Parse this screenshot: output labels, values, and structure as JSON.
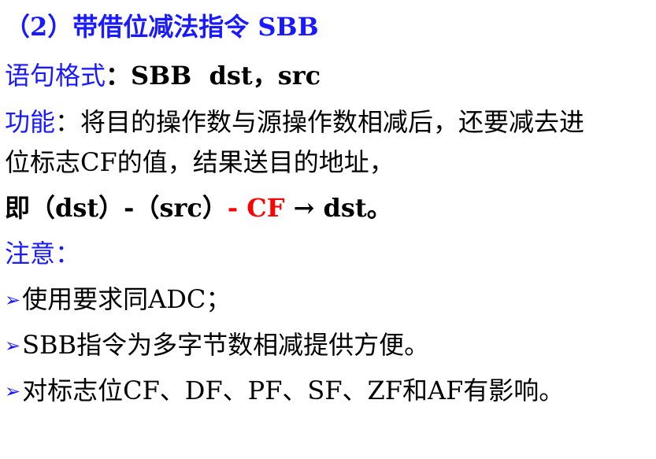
{
  "heading": "（2）带借位减法指令 SBB",
  "syntax": {
    "label": "语句格式",
    "colon": "：",
    "value": "SBB  dst，src"
  },
  "function": {
    "label": "功能",
    "colon": "：",
    "text_line1": "将目的操作数与源操作数相减后，还要减去进",
    "text_line2": "位标志CF的值，结果送目的地址，"
  },
  "formula": {
    "prefix": "即（dst）-（src）",
    "cf_part": "- CF",
    "suffix": " → dst。"
  },
  "notes": {
    "label": "注意：",
    "bullet_icon": "arrow-bullet",
    "items": [
      "使用要求同ADC；",
      "SBB指令为多字节数相减提供方便。",
      "对标志位CF、DF、PF、SF、ZF和AF有影响。"
    ]
  },
  "colors": {
    "accent_blue": "#1a1aff",
    "highlight_red": "#ff0000",
    "text": "#000000"
  }
}
